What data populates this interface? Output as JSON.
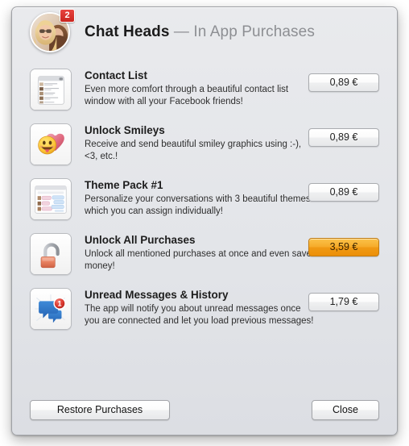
{
  "window": {
    "title_app": "Chat Heads",
    "title_separator": " — ",
    "title_section": "In App Purchases"
  },
  "header": {
    "avatar_icon": "user-photo-avatar",
    "badge_count": "2"
  },
  "products": [
    {
      "icon": "contact-list-window-icon",
      "title": "Contact List",
      "description": "Even more comfort through a beautiful contact list window with all your Facebook friends!",
      "price": "0,89 €",
      "highlighted": false
    },
    {
      "icon": "smiley-heart-icon",
      "title": "Unlock Smileys",
      "description": "Receive and send beautiful smiley graphics using :-), <3, etc.!",
      "price": "0,89 €",
      "highlighted": false
    },
    {
      "icon": "chat-theme-window-icon",
      "title": "Theme Pack #1",
      "description": "Personalize your conversations with 3 beautiful themes which you can assign individually!",
      "price": "0,89 €",
      "highlighted": false
    },
    {
      "icon": "open-padlock-icon",
      "title": "Unlock All Purchases",
      "description": "Unlock all mentioned purchases at once and even save money!",
      "price": "3,59 €",
      "highlighted": true
    },
    {
      "icon": "speech-bubble-badge-icon",
      "title": "Unread Messages & History",
      "description": "The app will notify you about unread messages once you are connected and let you load previous messages!",
      "price": "1,79 €",
      "highlighted": false
    }
  ],
  "footer": {
    "restore_label": "Restore Purchases",
    "close_label": "Close"
  },
  "colors": {
    "window_background": "#e3e5e9",
    "highlight_price": "#f3a51c",
    "badge_red": "#d32b25",
    "title_app": "#1b1b1b",
    "title_section": "#8d8f93"
  }
}
